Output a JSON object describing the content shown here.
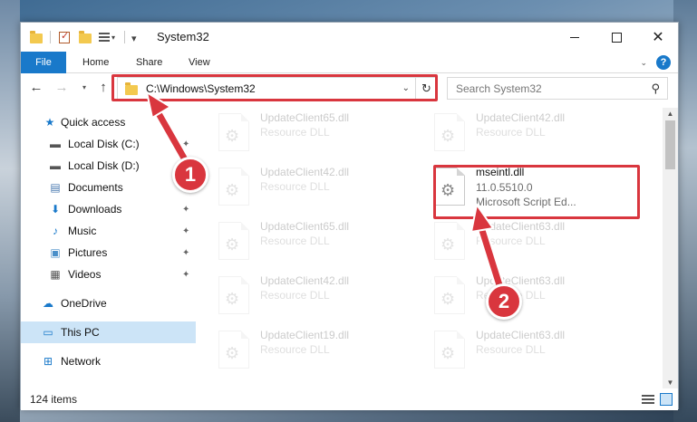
{
  "window": {
    "title": "System32"
  },
  "ribbon": {
    "tabs": [
      "File",
      "Home",
      "Share",
      "View"
    ]
  },
  "navigation": {
    "address": "C:\\Windows\\System32",
    "search_placeholder": "Search System32"
  },
  "sidebar": {
    "items": [
      {
        "label": "Quick access",
        "icon": "star-icon"
      },
      {
        "label": "Local Disk (C:)",
        "icon": "drive-icon"
      },
      {
        "label": "Local Disk (D:)",
        "icon": "drive-icon"
      },
      {
        "label": "Documents",
        "icon": "document-icon"
      },
      {
        "label": "Downloads",
        "icon": "download-icon"
      },
      {
        "label": "Music",
        "icon": "music-icon"
      },
      {
        "label": "Pictures",
        "icon": "picture-icon"
      },
      {
        "label": "Videos",
        "icon": "video-icon"
      },
      {
        "label": "OneDrive",
        "icon": "cloud-icon"
      },
      {
        "label": "This PC",
        "icon": "computer-icon"
      },
      {
        "label": "Network",
        "icon": "network-icon"
      }
    ]
  },
  "files": {
    "left_column": [
      {
        "name": "UpdateClient65.dll",
        "sub": "Resource DLL"
      },
      {
        "name": "UpdateClient42.dll",
        "sub": "Resource DLL"
      },
      {
        "name": "UpdateClient65.dll",
        "sub": "Resource DLL"
      },
      {
        "name": "UpdateClient42.dll",
        "sub": "Resource DLL"
      },
      {
        "name": "UpdateClient19.dll",
        "sub": "Resource DLL"
      }
    ],
    "right_column": [
      {
        "name": "UpdateClient42.dll",
        "sub": "Resource DLL"
      },
      {
        "name": "UpdateClient63.dll",
        "sub": "Resource DLL"
      },
      {
        "name": "UpdateClient63.dll",
        "sub": "Resource DLL"
      },
      {
        "name": "UpdateClient63.dll",
        "sub": "Resource DLL"
      }
    ],
    "selected": {
      "name": "mseintl.dll",
      "version": "11.0.5510.0",
      "description": "Microsoft Script Ed..."
    }
  },
  "status": {
    "item_count": "124 items"
  },
  "annotations": {
    "step1": "1",
    "step2": "2"
  },
  "colors": {
    "accent": "#1979ca",
    "highlight": "#d9363e",
    "selected_bg": "#cce4f7"
  }
}
